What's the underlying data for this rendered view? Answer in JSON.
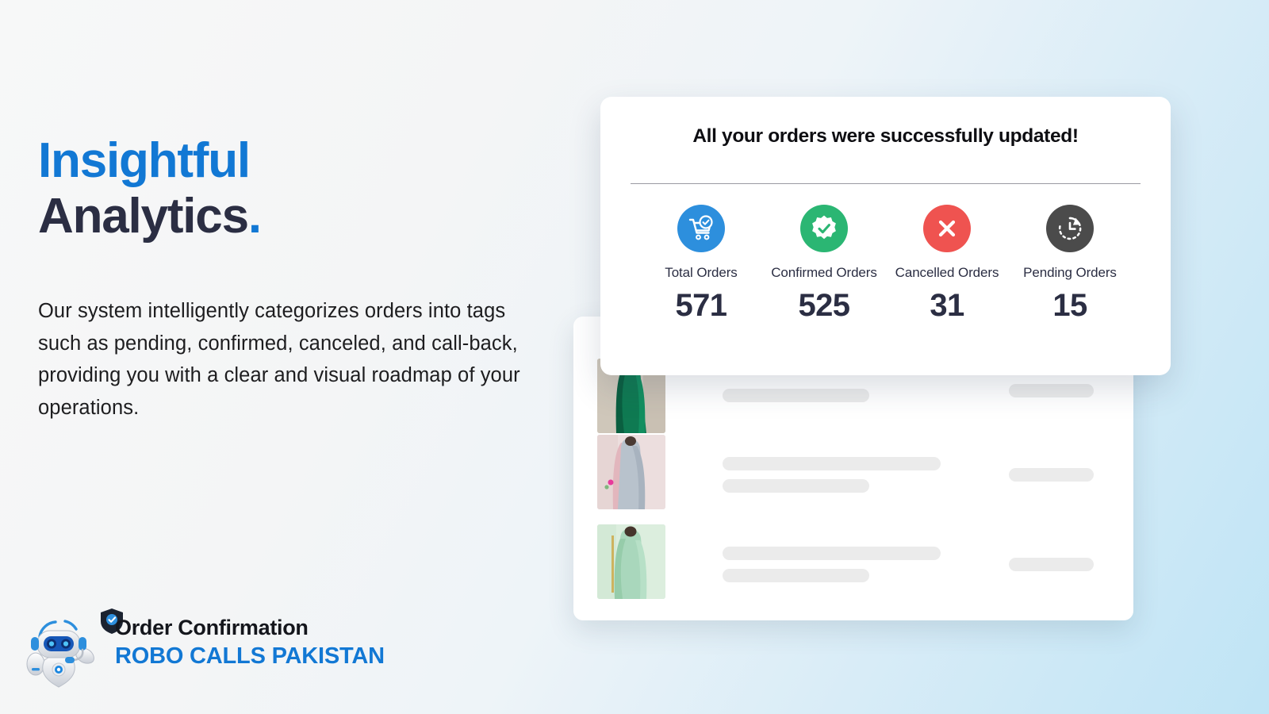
{
  "theme": {
    "brand_blue": "#1278d4",
    "headline_dark": "#2b2e43",
    "bg_light": "#f7f8f8",
    "bg_blue": "#bfe4f5"
  },
  "hero": {
    "headline_line1": "Insightful",
    "headline_line2": "Analytics",
    "headline_period": ".",
    "body": "Our system intelligently categorizes orders into tags such as pending, confirmed, canceled, and call-back, providing you with a clear and visual roadmap of your operations."
  },
  "brand": {
    "logo_icon": "robot-mascot-icon",
    "shield_icon": "shield-check-icon",
    "title": "Order Confirmation",
    "name": "ROBO CALLS PAKISTAN"
  },
  "summary_card": {
    "title": "All your orders were successfully updated!",
    "stats": [
      {
        "label": "Total Orders",
        "value": "571",
        "icon": "cart-check-icon",
        "color": "#2d8fdd"
      },
      {
        "label": "Confirmed Orders",
        "value": "525",
        "icon": "badge-check-icon",
        "color": "#2bb673"
      },
      {
        "label": "Cancelled Orders",
        "value": "31",
        "icon": "circle-x-icon",
        "color": "#ef5350"
      },
      {
        "label": "Pending Orders",
        "value": "15",
        "icon": "clock-restore-icon",
        "color": "#4b4b4b"
      }
    ]
  },
  "order_list": {
    "rows": [
      {
        "thumb_icon": "dress-thumbnail-emerald",
        "thumb_colors": [
          "#0f7a52",
          "#d9cfc4"
        ]
      },
      {
        "thumb_icon": "dress-thumbnail-silver",
        "thumb_colors": [
          "#b8c2cc",
          "#e8d8d8"
        ]
      },
      {
        "thumb_icon": "dress-thumbnail-mint",
        "thumb_colors": [
          "#a9d7bc",
          "#d9ecdd"
        ]
      }
    ],
    "skeleton_placeholder_color": "#ebebeb"
  }
}
